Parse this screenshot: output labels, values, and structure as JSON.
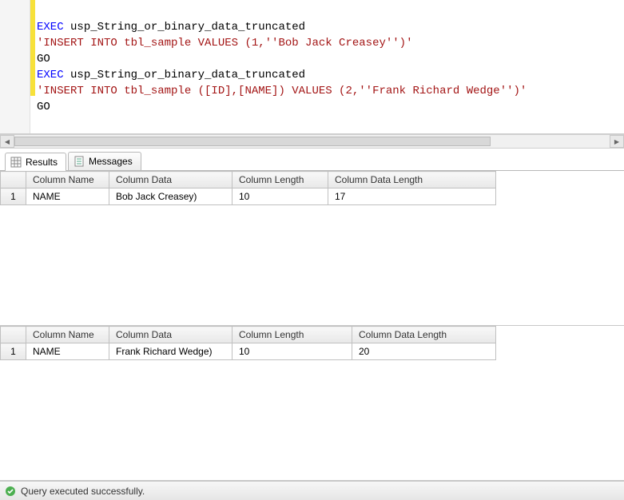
{
  "editor": {
    "line1_exec": "EXEC",
    "line1_proc": " usp_String_or_binary_data_truncated",
    "line2_str": "'INSERT INTO tbl_sample VALUES (1,''Bob Jack Creasey'')'",
    "line3_go": "GO",
    "line4_exec": "EXEC",
    "line4_proc": " usp_String_or_binary_data_truncated",
    "line5_str": "'INSERT INTO tbl_sample ([ID],[NAME]) VALUES (2,''Frank Richard Wedge'')'",
    "line6_go": "GO"
  },
  "tabs": {
    "results": "Results",
    "messages": "Messages"
  },
  "headers": {
    "col_name": "Column Name",
    "col_data": "Column Data",
    "col_len": "Column Length",
    "col_dlen": "Column Data Length"
  },
  "grid1": {
    "rows": [
      {
        "n": "1",
        "name": "NAME",
        "data": "Bob Jack Creasey)",
        "len": "10",
        "dlen": "17"
      }
    ]
  },
  "grid2": {
    "rows": [
      {
        "n": "1",
        "name": "NAME",
        "data": "Frank Richard Wedge)",
        "len": "10",
        "dlen": "20"
      }
    ]
  },
  "status": {
    "text": "Query executed successfully."
  }
}
